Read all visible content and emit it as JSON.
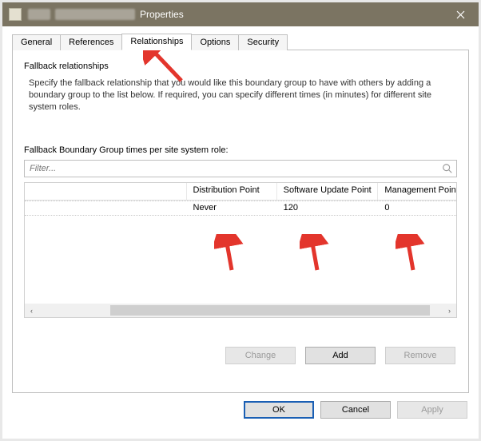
{
  "title_suffix": "Properties",
  "tabs": {
    "general": "General",
    "references": "References",
    "relationships": "Relationships",
    "options": "Options",
    "security": "Security"
  },
  "section": {
    "header": "Fallback relationships",
    "description": "Specify the fallback relationship that you would like this boundary group to have with others by adding a boundary group to the list below. If required, you can specify different times (in minutes) for different site system roles."
  },
  "grid": {
    "subheader": "Fallback Boundary Group times per site system role:",
    "filter_placeholder": "Filter...",
    "columns": {
      "name": "",
      "dp": "Distribution Point",
      "sup": "Software Update Point",
      "mp": "Management Point"
    },
    "rows": [
      {
        "name": "",
        "dp": "Never",
        "sup": "120",
        "mp": "0"
      }
    ]
  },
  "buttons": {
    "change": "Change",
    "add": "Add",
    "remove": "Remove",
    "ok": "OK",
    "cancel": "Cancel",
    "apply": "Apply"
  },
  "colors": {
    "titlebar": "#7b7462",
    "accent": "#1a5fb4",
    "arrow": "#e3352c"
  }
}
